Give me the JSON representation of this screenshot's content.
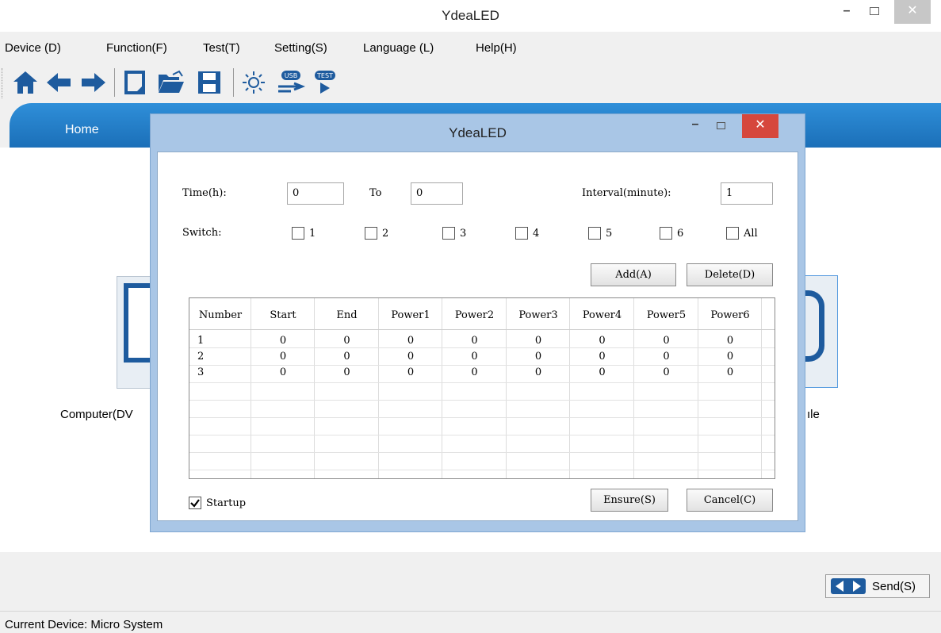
{
  "window": {
    "title": "YdeaLED"
  },
  "menubar": {
    "items": [
      {
        "label": "Device (D)"
      },
      {
        "label": "Function(F)"
      },
      {
        "label": "Test(T)"
      },
      {
        "label": "Setting(S)"
      },
      {
        "label": "Language (L)"
      },
      {
        "label": "Help(H)"
      }
    ]
  },
  "toolbar": {
    "icons": [
      "home-icon",
      "back-arrow-icon",
      "forward-arrow-icon",
      "new-file-icon",
      "open-folder-icon",
      "save-icon",
      "brightness-icon",
      "usb-icon",
      "test-icon"
    ],
    "usb_label": "USB",
    "test_label": "TEST"
  },
  "tabs": {
    "home": "Home"
  },
  "main": {
    "left_label": "Computer(DV",
    "right_label": "ıle",
    "send_button": "Send(S)",
    "status": "Current Device: Micro System"
  },
  "dialog": {
    "title": "YdeaLED",
    "time_label": "Time(h):",
    "time_from": "0",
    "to_label": "To",
    "time_to": "0",
    "interval_label": "Interval(minute):",
    "interval_value": "1",
    "switch_label": "Switch:",
    "switches": [
      "1",
      "2",
      "3",
      "4",
      "5",
      "6",
      "All"
    ],
    "add_button": "Add(A)",
    "delete_button": "Delete(D)",
    "ensure_button": "Ensure(S)",
    "cancel_button": "Cancel(C)",
    "startup_label": "Startup",
    "startup_checked": true,
    "table": {
      "columns": [
        "Number",
        "Start",
        "End",
        "Power1",
        "Power2",
        "Power3",
        "Power4",
        "Power5",
        "Power6"
      ],
      "rows": [
        [
          "1",
          "0",
          "0",
          "0",
          "0",
          "0",
          "0",
          "0",
          "0"
        ],
        [
          "2",
          "0",
          "0",
          "0",
          "0",
          "0",
          "0",
          "0",
          "0"
        ],
        [
          "3",
          "0",
          "0",
          "0",
          "0",
          "0",
          "0",
          "0",
          "0"
        ]
      ]
    }
  },
  "colors": {
    "accent": "#1b6fb8",
    "close": "#d6473d",
    "dialog_frame": "#a9c6e6"
  }
}
